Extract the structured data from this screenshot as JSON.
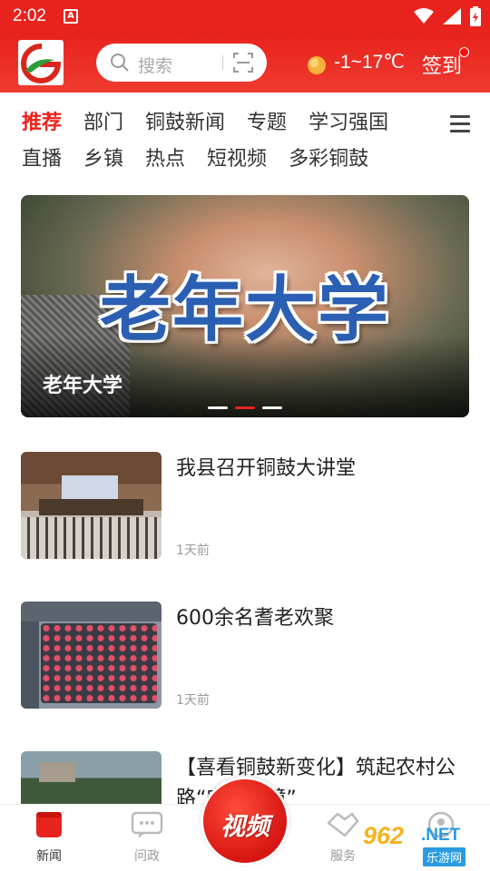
{
  "status_bar": {
    "time": "2:02",
    "notification_icon": "letter-a-icon"
  },
  "header": {
    "search_placeholder": "搜索",
    "weather": "-1~17℃",
    "signin_label": "签到"
  },
  "channels": {
    "row1": [
      "推荐",
      "部门",
      "铜鼓新闻",
      "专题",
      "学习强国"
    ],
    "row2": [
      "直播",
      "乡镇",
      "热点",
      "短视频",
      "多彩铜鼓"
    ],
    "active": "推荐"
  },
  "banner": {
    "overlay_text": "老年大学",
    "caption": "老年大学",
    "slides": 3,
    "active_slide": 2
  },
  "news": [
    {
      "title": "我县召开铜鼓大讲堂",
      "time": "1天前"
    },
    {
      "title": "600余名耆老欢聚",
      "time": "1天前"
    },
    {
      "title": "【喜看铜鼓新变化】筑起农村公路“安全屏障”",
      "time": ""
    }
  ],
  "tabbar": {
    "news": "新闻",
    "wenzheng": "问政",
    "video": "视频",
    "fuwu": "服务",
    "mine": ""
  },
  "watermark": {
    "number": "962",
    "net": ".NET",
    "sub": "乐游网"
  },
  "colors": {
    "brand": "#e8221d",
    "inactive": "#999999"
  }
}
